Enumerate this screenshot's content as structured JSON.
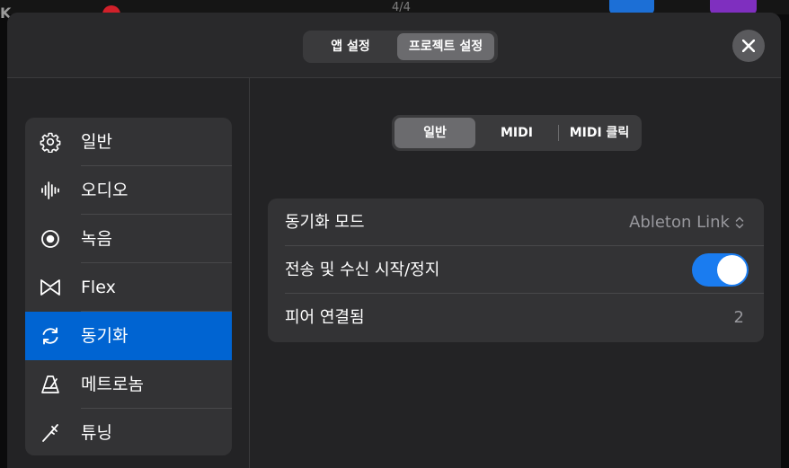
{
  "background": {
    "time_signature": "4/4",
    "colors": {
      "record": "#d1202a",
      "blue_button": "#1c6fd6",
      "purple_button": "#7f2fbf"
    }
  },
  "header": {
    "tabs": [
      {
        "label": "앱 설정",
        "active": false
      },
      {
        "label": "프로젝트 설정",
        "active": true
      }
    ],
    "close_icon": "close-icon"
  },
  "sidebar": {
    "items": [
      {
        "label": "일반",
        "icon": "gear-icon",
        "active": false
      },
      {
        "label": "오디오",
        "icon": "waveform-icon",
        "active": false
      },
      {
        "label": "녹음",
        "icon": "record-icon",
        "active": false
      },
      {
        "label": "Flex",
        "icon": "flex-icon",
        "active": false
      },
      {
        "label": "동기화",
        "icon": "sync-icon",
        "active": true
      },
      {
        "label": "메트로놈",
        "icon": "metronome-icon",
        "active": false
      },
      {
        "label": "튜닝",
        "icon": "tuning-fork-icon",
        "active": false
      }
    ],
    "accent": "#0064d2"
  },
  "main": {
    "tabs": [
      {
        "label": "일반",
        "active": true
      },
      {
        "label": "MIDI",
        "active": false
      },
      {
        "label": "MIDI 클릭",
        "active": false
      }
    ],
    "settings": [
      {
        "label": "동기화 모드",
        "value": "Ableton Link",
        "control": "popup"
      },
      {
        "label": "전송 및 수신 시작/정지",
        "control": "toggle",
        "on": true
      },
      {
        "label": "피어 연결됨",
        "value": "2",
        "control": "readonly"
      }
    ],
    "toggle_color": "#1a7cf0"
  }
}
